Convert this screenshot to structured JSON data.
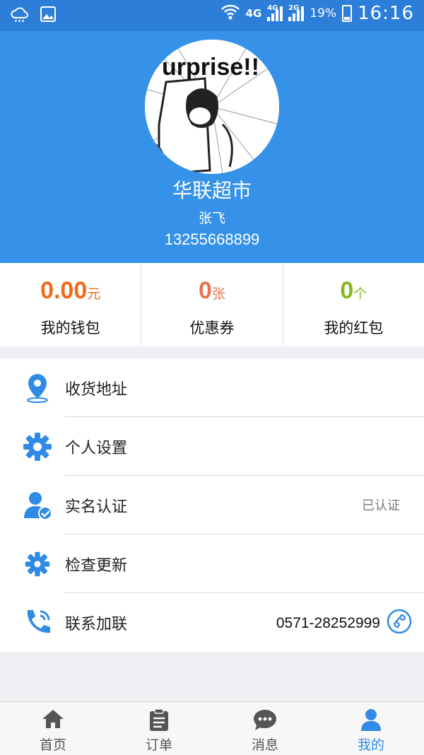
{
  "status_bar": {
    "net1": "4G",
    "net2": "4G",
    "net3": "2G",
    "battery": "19%",
    "time": "16:16"
  },
  "profile": {
    "avatar_text": "urprise!!",
    "shop_name": "华联超市",
    "user_name": "张飞",
    "phone": "13255668899"
  },
  "stats": [
    {
      "value": "0.00",
      "unit": "元",
      "label": "我的钱包",
      "color": "#f26a1b"
    },
    {
      "value": "0",
      "unit": "张",
      "label": "优惠券",
      "color": "#e8734f"
    },
    {
      "value": "0",
      "unit": "个",
      "label": "我的红包",
      "color": "#86b81e"
    }
  ],
  "menu": [
    {
      "label": "收货地址",
      "icon": "location-pin-icon"
    },
    {
      "label": "个人设置",
      "icon": "gear-icon"
    },
    {
      "label": "实名认证",
      "icon": "verified-user-icon",
      "right": "已认证"
    },
    {
      "label": "检查更新",
      "icon": "update-gear-icon"
    },
    {
      "label": "联系加联",
      "icon": "phone-call-icon",
      "right": "0571-28252999"
    }
  ],
  "tabs": [
    {
      "label": "首页",
      "icon": "home-icon"
    },
    {
      "label": "订单",
      "icon": "clipboard-icon"
    },
    {
      "label": "消息",
      "icon": "chat-bubble-icon"
    },
    {
      "label": "我的",
      "icon": "person-icon",
      "active": true
    }
  ],
  "colors": {
    "header": "#3592e8",
    "status_bar": "#2c7ed8",
    "accent": "#2f8be6",
    "icon": "#2f8be6"
  }
}
